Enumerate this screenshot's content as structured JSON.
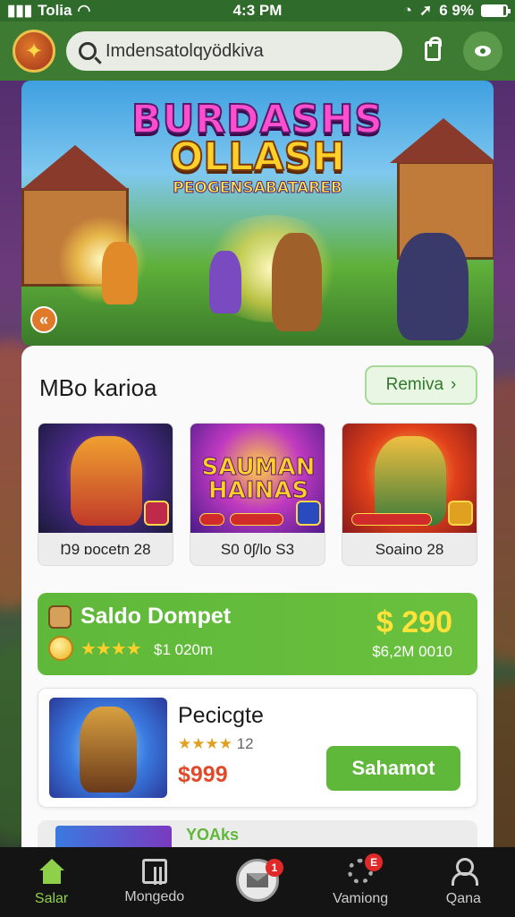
{
  "status_bar": {
    "carrier": "Tolia",
    "time": "4:3 PM",
    "battery": "6 9%",
    "battery_level": 0.9
  },
  "header": {
    "search_placeholder": "Imdensatolqyödkiva",
    "icons": [
      "avatar",
      "search-icon",
      "lock-icon",
      "eye-icon"
    ]
  },
  "banner": {
    "title_line1": "BURDASHS",
    "title_line2": "OLLASH",
    "subtitle": "PEOGENSABATAREB"
  },
  "section": {
    "title": "MBo karioa",
    "see_all": "Remiva",
    "games": [
      {
        "label": "Ŋ9 ɒocetn 28",
        "theme": "#2a2a4a"
      },
      {
        "label": "S0 0ʃ/lo S3",
        "theme": "#7a2ac0",
        "logo": "SAUMAN HAINAS"
      },
      {
        "label": "Soaino 28",
        "theme": "#d0301a"
      }
    ]
  },
  "wallet": {
    "title": "Saldo Dompet",
    "stars": "★★★★",
    "sub": "$1 020m",
    "amount": "$ 290",
    "amount_sub": "$6,2M 0010"
  },
  "product": {
    "name": "Pecicgte",
    "stars": "★★★★",
    "rating": "12",
    "price": "$999",
    "buy_label": "Sahamot"
  },
  "peek": {
    "text": "YOAks"
  },
  "bottom_nav": {
    "items": [
      {
        "label": "Salar",
        "icon": "home-icon",
        "active": true
      },
      {
        "label": "Mongedo",
        "icon": "grid-icon"
      },
      {
        "label": "",
        "icon": "mail-icon",
        "badge": "1"
      },
      {
        "label": "Vamiong",
        "icon": "gear-icon",
        "badge": "E"
      },
      {
        "label": "Qana",
        "icon": "user-icon"
      }
    ]
  },
  "colors": {
    "primary_green": "#5fb83a",
    "header_green": "#3d7a32",
    "price_red": "#e04a2a",
    "gold": "#ffe23a"
  }
}
